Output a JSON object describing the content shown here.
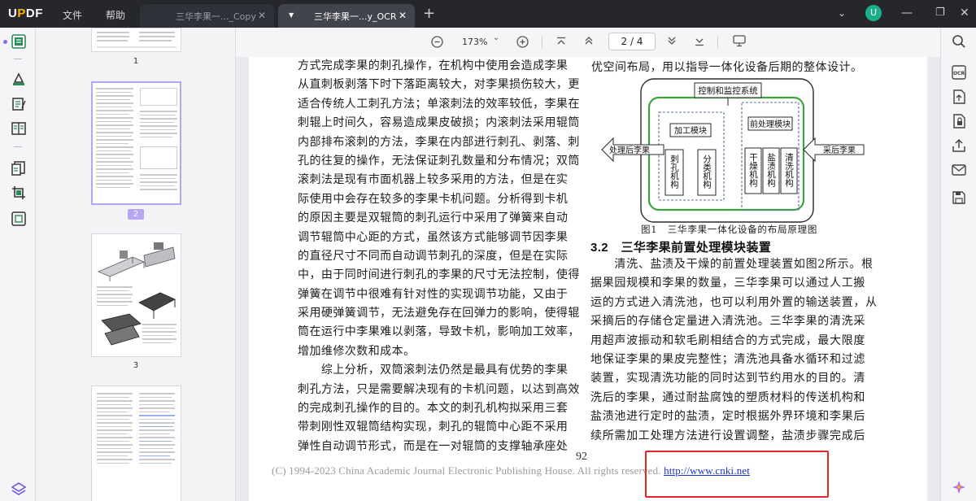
{
  "app": {
    "logo": "UPDF",
    "menu": [
      "文件",
      "帮助"
    ],
    "tabs": [
      {
        "label": "三华李果一..._Copy",
        "active": false
      },
      {
        "label": "三华李果一...y_OCR",
        "active": true
      }
    ],
    "avatar_letter": "U"
  },
  "toolbar": {
    "zoom": "173%",
    "page_current": "2",
    "page_total": "4",
    "page_display": "2  /  4"
  },
  "thumbnails": [
    {
      "label": "1",
      "selected": false
    },
    {
      "label": "2",
      "selected": true
    },
    {
      "label": "3",
      "selected": false
    }
  ],
  "document": {
    "top_right_line": "优空间布局，用以指导一体化设备后期的整体设计。",
    "left_column": [
      "方式完成李果的刺孔操作，在机构中使用会造成李果",
      "从直刺板剥落下时下落距离较大，对李果损伤较大，更",
      "适合传统人工刺孔方法；单滚刺法的效率较低，李果在",
      "刺辊上时间久，容易造成果皮破损；内滚刺法采用辊筒",
      "内部排布滚刺的方法，李果在内部进行刺孔、剥落、刺",
      "孔的往复的操作，无法保证刺孔数量和分布情况；双筒",
      "滚刺法是现有市面机器上较多采用的方法，但是在实",
      "际使用中会存在较多的李果卡机问题。分析得到卡机",
      "的原因主要是双辊筒的刺孔运行中采用了弹簧来自动",
      "调节辊筒中心距的方式，虽然该方式能够调节因李果",
      "的直径尺寸不同而自动调节刺孔的深度，但是在实际",
      "中，由于同时间进行刺孔的李果的尺寸无法控制，使得",
      "弹簧在调节中很难有针对性的实现调节功能，又由于",
      "采用硬弹簧调节，无法避免存在回弹力的影响，使得辊",
      "筒在运行中李果难以剥落，导致卡机，影响加工效率，",
      "增加维修次数和成本。",
      "　　综上分析，双筒滚刺法仍然是最具有优势的李果",
      "刺孔方法，只是需要解决现有的卡机问题，以达到高效",
      "的完成刺孔操作的目的。本文的刺孔机构拟采用三套",
      "带刺刚性双辊筒结构实现，刺孔的辊筒中心距不采用",
      "弹性自动调节形式，而是在一对辊筒的支撑轴承座处"
    ],
    "figure": {
      "control_label": "控制和监控系统",
      "process_module": "加工模块",
      "pre_module": "前处理模块",
      "pierce": "刺孔机构",
      "sort": "分类机构",
      "dry": "干燥机构",
      "salt": "盐渍机构",
      "wash": "清洗机构",
      "output": "处理后李果",
      "input": "采后李果",
      "caption": "图1　三华李果一体化设备的布局原理图"
    },
    "section_heading": "3.2　三华李果前置处理模块装置",
    "right_column": [
      "　　清洗、盐渍及干燥的前置处理装置如图2所示。根",
      "据果园规模和李果的数量，三华李果可以通过人工搬",
      "运的方式进入清洗池，也可以利用外置的输送装置，从",
      "采摘后的存储仓定量进入清洗池。三华李果的清洗采",
      "用超声波振动和软毛刷相结合的方式完成，最大限度",
      "地保证李果的果皮完整性；清洗池具备水循环和过滤",
      "装置，实现清洗功能的同时达到节约用水的目的。清",
      "洗后的李果，通过耐盐腐蚀的塑质材料的传送机构和",
      "盐渍池进行定时的盐渍，定时根据外界环境和李果后",
      "续所需加工处理方法进行设置调整，盐渍步骤完成后"
    ],
    "page_number": "92",
    "footer_text": "(C) 1994-2023 China Academic Journal Electronic Publishing House. All rights reserved.",
    "footer_link": "http://www.cnki.net"
  },
  "colors": {
    "titlebar": "#25272d",
    "accent": "#8a6cf0",
    "annotation": "#e5262a",
    "link": "#1a33cc"
  }
}
